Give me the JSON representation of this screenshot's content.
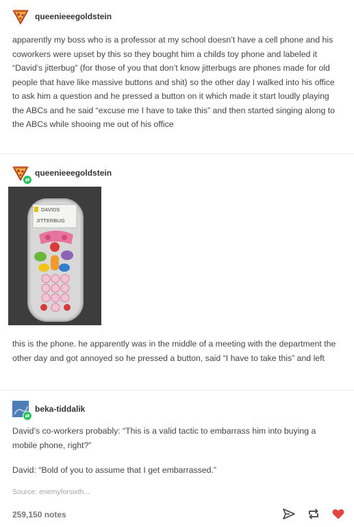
{
  "post1": {
    "username": "queenieeegoldstein",
    "text": "apparently my boss who is a professor at my school doesn’t have a cell phone and his coworkers were upset by this so they bought him a childs toy phone and labeled it “David’s jitterbug” (for those of you that don’t know jitterbugs are phones made for old people that have like massive buttons and shit) so the other day I walked into his office to ask him a question and he pressed a button on it which made it start loudly playing the ABCs and he said “excuse me I have to take this” and then started singing along to the ABCs while shooing me out of his office"
  },
  "post2": {
    "username": "queenieeegoldstein",
    "photo_label_line1": "DAVIDS",
    "photo_label_line2": "JITTERBUG",
    "text": "this is the phone. he apparently was in the middle of a meeting with the department the other day and got annoyed so he pressed a button, said “I have to take this” and left"
  },
  "post3": {
    "username": "beka-tiddalik",
    "text1": "David’s co-workers probably: “This is a valid tactic to embarrass him into buying a mobile phone, right?”",
    "text2": "David: “Bold of you to assume that I get embarrassed.”"
  },
  "source": "Source:  enemyforsixth...",
  "notes": "259,150 notes",
  "icons": {
    "share": "paper-plane-icon",
    "reblog": "reblog-icon",
    "like": "heart-icon"
  },
  "colors": {
    "heart": "#e0453e",
    "reblog_badge": "#21c55a",
    "beka_avatar": "#4d7db4"
  }
}
